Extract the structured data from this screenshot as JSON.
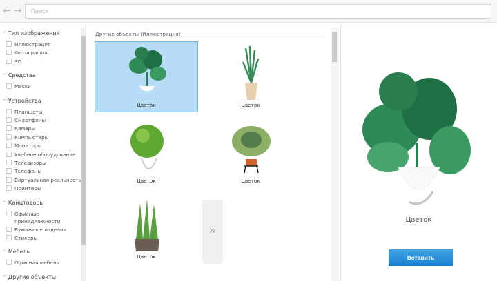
{
  "toolbar": {
    "back_icon": "arrow-left",
    "forward_icon": "arrow-right",
    "search_placeholder": "Поиск"
  },
  "sidebar": {
    "sections": [
      {
        "title": "Тип изображения",
        "items": [
          "Иллюстрация",
          "Фотография",
          "3D"
        ]
      },
      {
        "title": "Средства",
        "items": [
          "Маски"
        ]
      },
      {
        "title": "Устройства",
        "items": [
          "Планшеты",
          "Смартфоны",
          "Камеры",
          "Компьютеры",
          "Мониторы",
          "Учебное оборудование",
          "Телевизоры",
          "Телефоны",
          "Виртуальная реальность",
          "Принтеры"
        ]
      },
      {
        "title": "Канцтовары",
        "items": [
          "Офисные принадлежности",
          "Бумажные изделия",
          "Стикеры"
        ]
      },
      {
        "title": "Мебель",
        "items": [
          "Офисная мебель"
        ]
      },
      {
        "title": "Другие объекты",
        "items": []
      }
    ]
  },
  "main": {
    "group_title": "Другие объекты (Иллюстрация)",
    "tiles": [
      {
        "label": "Цветок",
        "selected": true
      },
      {
        "label": "Цветок"
      },
      {
        "label": "Цветок"
      },
      {
        "label": "Цветок"
      },
      {
        "label": "Цветок"
      }
    ],
    "more_label": "»"
  },
  "preview": {
    "name": "Цветок",
    "insert_label": "Вставить"
  },
  "colors": {
    "accent": "#1c82cf",
    "selection": "#b7dcf5"
  }
}
